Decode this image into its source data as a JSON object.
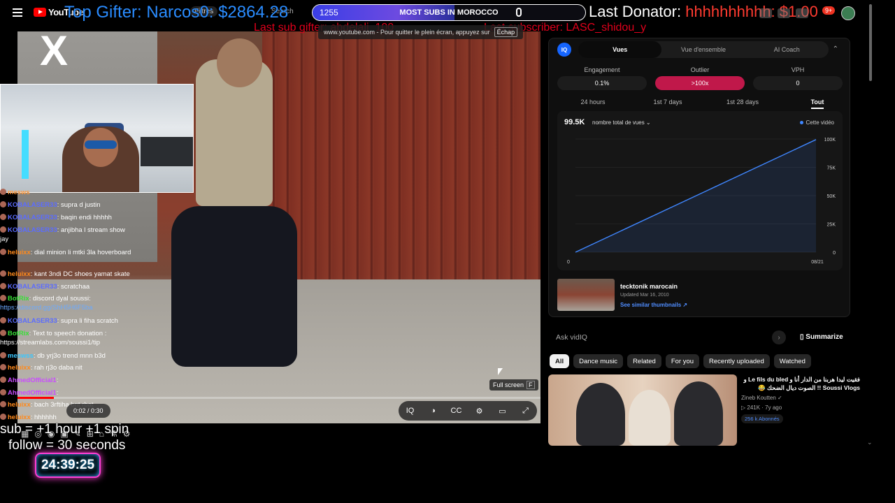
{
  "youtube": {
    "logo_text": "YouTube",
    "filter_chip": "Filtres",
    "search_ghost": "Search",
    "notif_badge": "9+"
  },
  "overlay": {
    "top_gifter": "Top Gifter: Narcos0: $2864.28",
    "goal_count": "1255",
    "goal_title": "MOST SUBS IN MOROCCO",
    "goal_progress": 0.52,
    "last_donator_label": "Last Donator:",
    "last_donator_amount": "hhhhhhhhhh: $1.00",
    "last_sub_gifter": "Last sub gifter: abdelali_100",
    "last_subscriber": "Last subscriber: LASC_shidou_y",
    "rule_sub": "sub = +1 hour +1 spin",
    "rule_follow": "follow = 30 seconds",
    "timer": "24:39:25"
  },
  "fullscreen_toast": {
    "text": "www.youtube.com - Pour quitter le plein écran, appuyez sur",
    "key": "Échap"
  },
  "video": {
    "brand": "X",
    "time": "0:02 / 0:30",
    "progress": 0.07,
    "fullscreen_tip": "Full screen",
    "fullscreen_key": "F",
    "controls": [
      "IQ",
      "◑",
      "CC",
      "⚙",
      "▭",
      "⤢"
    ]
  },
  "chat": [
    {
      "user": "mesws",
      "color": "#ff9a3c",
      "text": "",
      "y": 0
    },
    {
      "user": "KOBALASER33",
      "color": "#5b6cff",
      "text": ": supra d justin",
      "y": 18
    },
    {
      "user": "KOBALASER33",
      "color": "#5b6cff",
      "text": ": baqin endi hhhhh",
      "y": 36
    },
    {
      "user": "KOBALASER33",
      "color": "#5b6cff",
      "text": ": anjibha l stream show",
      "y": 54
    },
    {
      "user": "",
      "color": "#fff",
      "text": "jay",
      "y": 68
    },
    {
      "user": "heluixx",
      "color": "#ff8a1c",
      "text": ": dial minion li mtki 3la hoverboard",
      "y": 86
    },
    {
      "user": "heluixx",
      "color": "#ff8a1c",
      "text": ": kant 3ndi DC shoes yamat skate",
      "y": 117
    },
    {
      "user": "KOBALASER33",
      "color": "#5b6cff",
      "text": ": scratchaa",
      "y": 135
    },
    {
      "user": "BotRix",
      "color": "#38e038",
      "text": ": discord dyal soussi:",
      "y": 152
    },
    {
      "user": "",
      "color": "#6aa9ff",
      "text": "https://discord.gg/ShH5H6F5ba",
      "y": 166,
      "link": true
    },
    {
      "user": "KOBALASER33",
      "color": "#5b6cff",
      "text": ": supra li fiha scratch",
      "y": 184
    },
    {
      "user": "BotRix",
      "color": "#38e038",
      "text": ": Text to speech donation :",
      "y": 202
    },
    {
      "user": "",
      "color": "#fff",
      "text": "https://streamlabs.com/soussi1/tip",
      "y": 216
    },
    {
      "user": "meswss",
      "color": "#3ac8ff",
      "text": ": db yrj3o trend mnn b3d",
      "y": 234
    },
    {
      "user": "heluixx",
      "color": "#ff8a1c",
      "text": ": rah rj3o daba nit",
      "y": 251
    },
    {
      "user": "AhmedOfficial1",
      "color": "#c94cff",
      "text": ":",
      "y": 269
    },
    {
      "user": "AhmedOfficial1",
      "color": "#c94cff",
      "text": ":",
      "y": 287
    },
    {
      "user": "heluixx",
      "color": "#ff8a1c",
      "text": ": bach 3rftiha bnt rbat",
      "y": 304
    },
    {
      "user": "heluixx",
      "color": "#ff8a1c",
      "text": ": hhhhhh",
      "y": 322
    }
  ],
  "vidiq": {
    "logo": "IQ",
    "tabs": [
      "Vues",
      "Vue d'ensemble",
      "AI Coach"
    ],
    "active_tab": 0,
    "metrics": [
      {
        "label": "Engagement",
        "value": "0.1%"
      },
      {
        "label": "Outlier",
        "value": ">100x",
        "hot": true
      },
      {
        "label": "VPH",
        "value": "0"
      }
    ],
    "ranges": [
      "24 hours",
      "1st 7 days",
      "1st 28 days",
      "Tout"
    ],
    "active_range": 3,
    "chart_total": "99.5K",
    "chart_metric": "nombre total de vues ⌄",
    "chart_legend": "Cette vidéo",
    "line_color": "#3f86ff",
    "video_title": "tecktonik marocain",
    "video_updated": "Updated Mar 16, 2010",
    "similar_link": "See similar thumbnails ↗",
    "ask_placeholder": "Ask vidIQ",
    "summarize": "Summarize"
  },
  "chart_data": {
    "type": "area",
    "x": [
      "0",
      "08/21"
    ],
    "y": [
      0,
      99500
    ],
    "yticks": [
      "0",
      "25K",
      "50K",
      "75K",
      "100K"
    ],
    "ylim": [
      0,
      100000
    ],
    "xlabel": "",
    "ylabel": "",
    "series": [
      {
        "name": "Cette vidéo",
        "values": [
          0,
          99500
        ]
      }
    ]
  },
  "chips": [
    "All",
    "Dance music",
    "Related",
    "For you",
    "Recently uploaded",
    "Watched"
  ],
  "recommendation": {
    "title": "فقيت ليدا هربنا من الدار  أنا و Le fils du bled و Soussi Vlogs !! الصوت ديال الضحك 😂",
    "channel": "Zineb Koutten ✓",
    "views": "▷ 241K · 7y ago",
    "subs": "256 k Abonnés"
  }
}
